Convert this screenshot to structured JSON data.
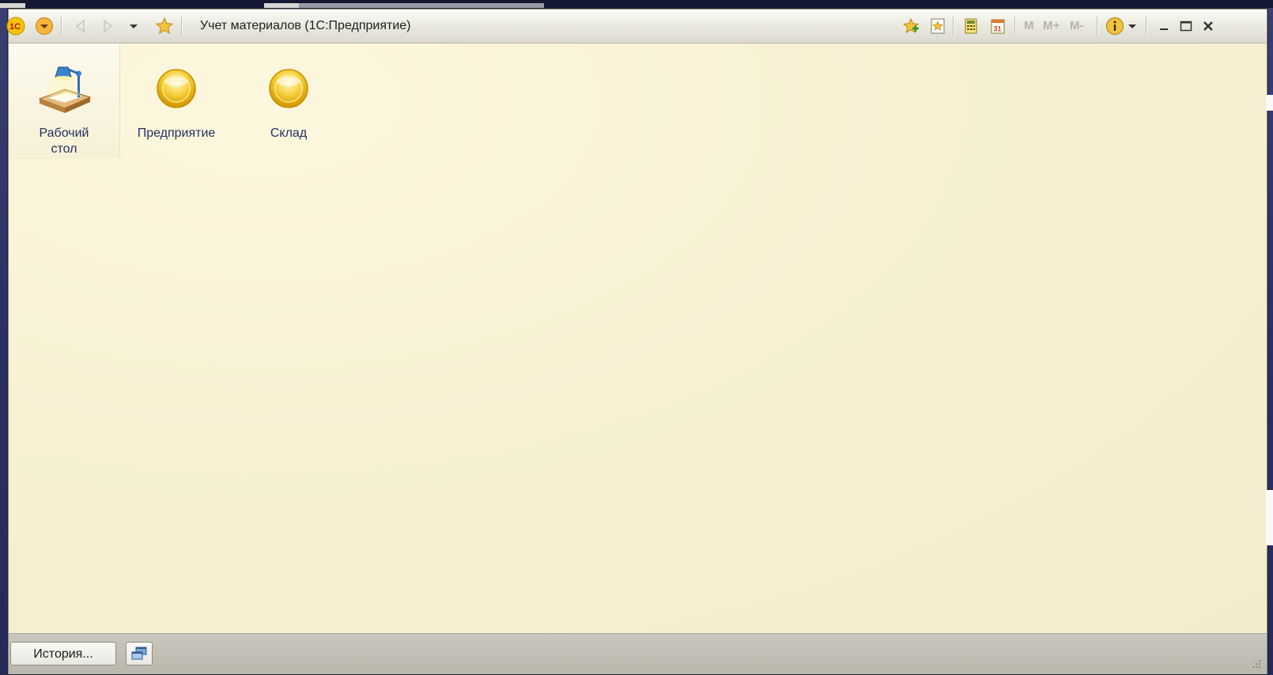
{
  "window": {
    "title": "Учет материалов  (1С:Предприятие)"
  },
  "toolbar": {
    "memory_m": "M",
    "memory_m_plus": "M+",
    "memory_m_minus": "M-"
  },
  "sections": [
    {
      "label_line1": "Рабочий",
      "label_line2": "стол",
      "active": true
    },
    {
      "label_line1": "Предприятие",
      "label_line2": "",
      "active": false
    },
    {
      "label_line1": "Склад",
      "label_line2": "",
      "active": false
    }
  ],
  "bottombar": {
    "history_label": "История..."
  },
  "colors": {
    "accent": "#f0b400",
    "content_bg": "#f7f0d3",
    "label_text": "#253060"
  }
}
